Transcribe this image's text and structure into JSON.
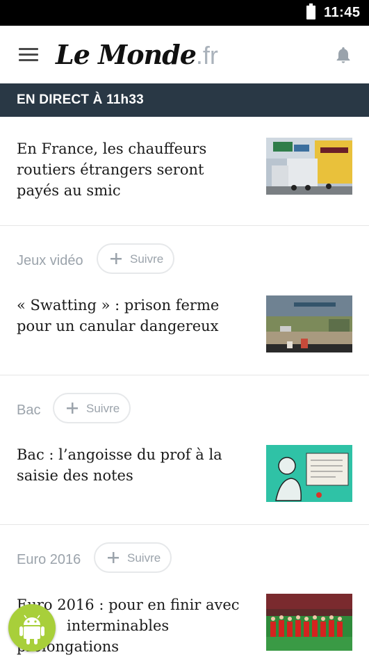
{
  "status_bar": {
    "time": "11:45"
  },
  "header": {
    "logo_main": "Le Monde",
    "logo_suffix": ".fr"
  },
  "live_banner": {
    "text": "EN DIRECT À 11h33"
  },
  "articles": [
    {
      "title_lines": [
        "En France, les chauffeurs",
        "routiers étrangers seront",
        "payés au smic"
      ]
    },
    {
      "topic": "Jeux vidéo",
      "follow_label": "Suivre",
      "title_lines": [
        "« Swatting » : prison ferme",
        "pour un canular dangereux"
      ]
    },
    {
      "topic": "Bac",
      "follow_label": "Suivre",
      "title_lines": [
        "Bac : l’angoisse du prof à la",
        "saisie des notes"
      ]
    },
    {
      "topic": "Euro 2016",
      "follow_label": "Suivre",
      "title_lines": [
        "Euro 2016 : pour en finir avec",
        "interminables",
        "prolongations"
      ]
    }
  ],
  "icons": {
    "menu": "menu-icon",
    "bell": "bell-icon",
    "plus": "plus-icon",
    "battery": "battery-icon",
    "android": "android-icon"
  },
  "colors": {
    "live_banner_bg": "#293845",
    "muted_text": "#9ba3ab",
    "logo_suffix": "#aab2bb",
    "android_green": "#a8cf3a"
  }
}
